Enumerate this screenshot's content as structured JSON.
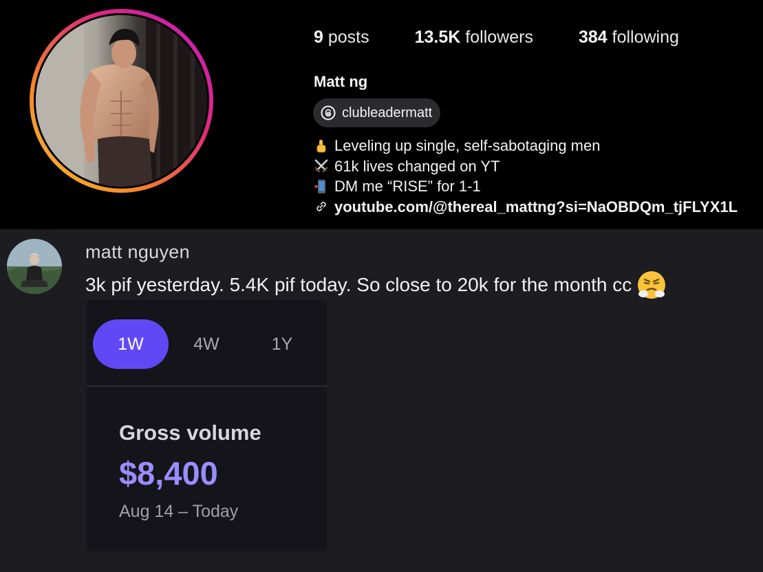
{
  "profile": {
    "stats": {
      "posts_count": "9",
      "posts_label": "posts",
      "followers_count": "13.5K",
      "followers_label": "followers",
      "following_count": "384",
      "following_label": "following"
    },
    "display_name": "Matt ng",
    "threads_handle": "clubleadermatt",
    "bio": [
      {
        "icon": "pointing-up-icon",
        "text": "Leveling up single, self-sabotaging men"
      },
      {
        "icon": "crossed-swords-icon",
        "text": "61k lives changed on YT"
      },
      {
        "icon": "phone-icon",
        "text": "DM me “RISE” for 1-1"
      }
    ],
    "link": {
      "icon": "link-icon",
      "text": "youtube.com/@thereal_mattng?si=NaOBDQm_tjFLYX1L"
    }
  },
  "post": {
    "author": "matt nguyen",
    "text": "3k pif yesterday. 5.4K pif today. So close to 20k for the month cc",
    "emoji": "steam-from-nose-face-icon"
  },
  "card": {
    "tabs": [
      {
        "label": "1W",
        "active": true
      },
      {
        "label": "4W",
        "active": false
      },
      {
        "label": "1Y",
        "active": false
      }
    ],
    "label": "Gross volume",
    "amount": "$8,400",
    "range": "Aug 14 – Today"
  },
  "colors": {
    "accent": "#6049f4",
    "amount": "#9b8cff",
    "ring_start": "#f9c33a",
    "ring_end": "#c51bc9"
  }
}
